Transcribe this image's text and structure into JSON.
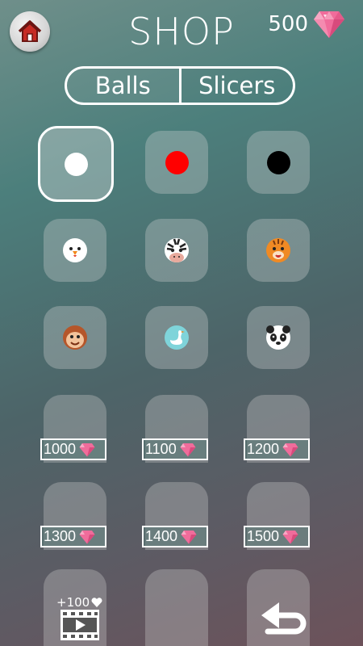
{
  "header": {
    "title": "SHOP",
    "gem_count": "500"
  },
  "tabs": [
    {
      "label": "Balls",
      "active": true
    },
    {
      "label": "Slicers",
      "active": false
    }
  ],
  "grid": {
    "owned": [
      {
        "kind": "dot",
        "color": "#ffffff",
        "selected": true
      },
      {
        "kind": "dot",
        "color": "#ff0000",
        "selected": false
      },
      {
        "kind": "dot",
        "color": "#000000",
        "selected": false
      },
      {
        "kind": "animal",
        "icon": "chicken-icon"
      },
      {
        "kind": "animal",
        "icon": "zebra-icon"
      },
      {
        "kind": "animal",
        "icon": "tiger-icon"
      },
      {
        "kind": "animal",
        "icon": "monkey-icon"
      },
      {
        "kind": "animal",
        "icon": "swan-icon"
      },
      {
        "kind": "animal",
        "icon": "panda-icon"
      }
    ],
    "locked": [
      {
        "price": "1000"
      },
      {
        "price": "1100"
      },
      {
        "price": "1200"
      },
      {
        "price": "1300"
      },
      {
        "price": "1400"
      },
      {
        "price": "1500"
      }
    ]
  },
  "footer": {
    "bonus": "+100",
    "video_icon": "video-icon",
    "back_icon": "back-arrow-icon"
  }
}
